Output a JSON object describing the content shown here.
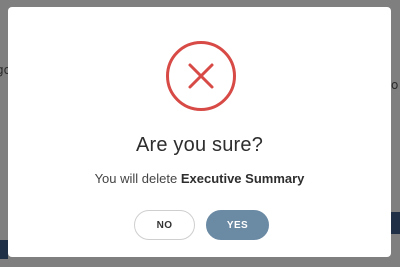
{
  "background": {
    "left_fragment": "go",
    "right_fragment": "o"
  },
  "dialog": {
    "icon": "close-icon",
    "icon_color": "#d74a46",
    "title": "Are you sure?",
    "message_prefix": "You will delete ",
    "message_item": "Executive Summary",
    "no_label": "NO",
    "yes_label": "YES",
    "yes_color": "#6b8aa4"
  }
}
